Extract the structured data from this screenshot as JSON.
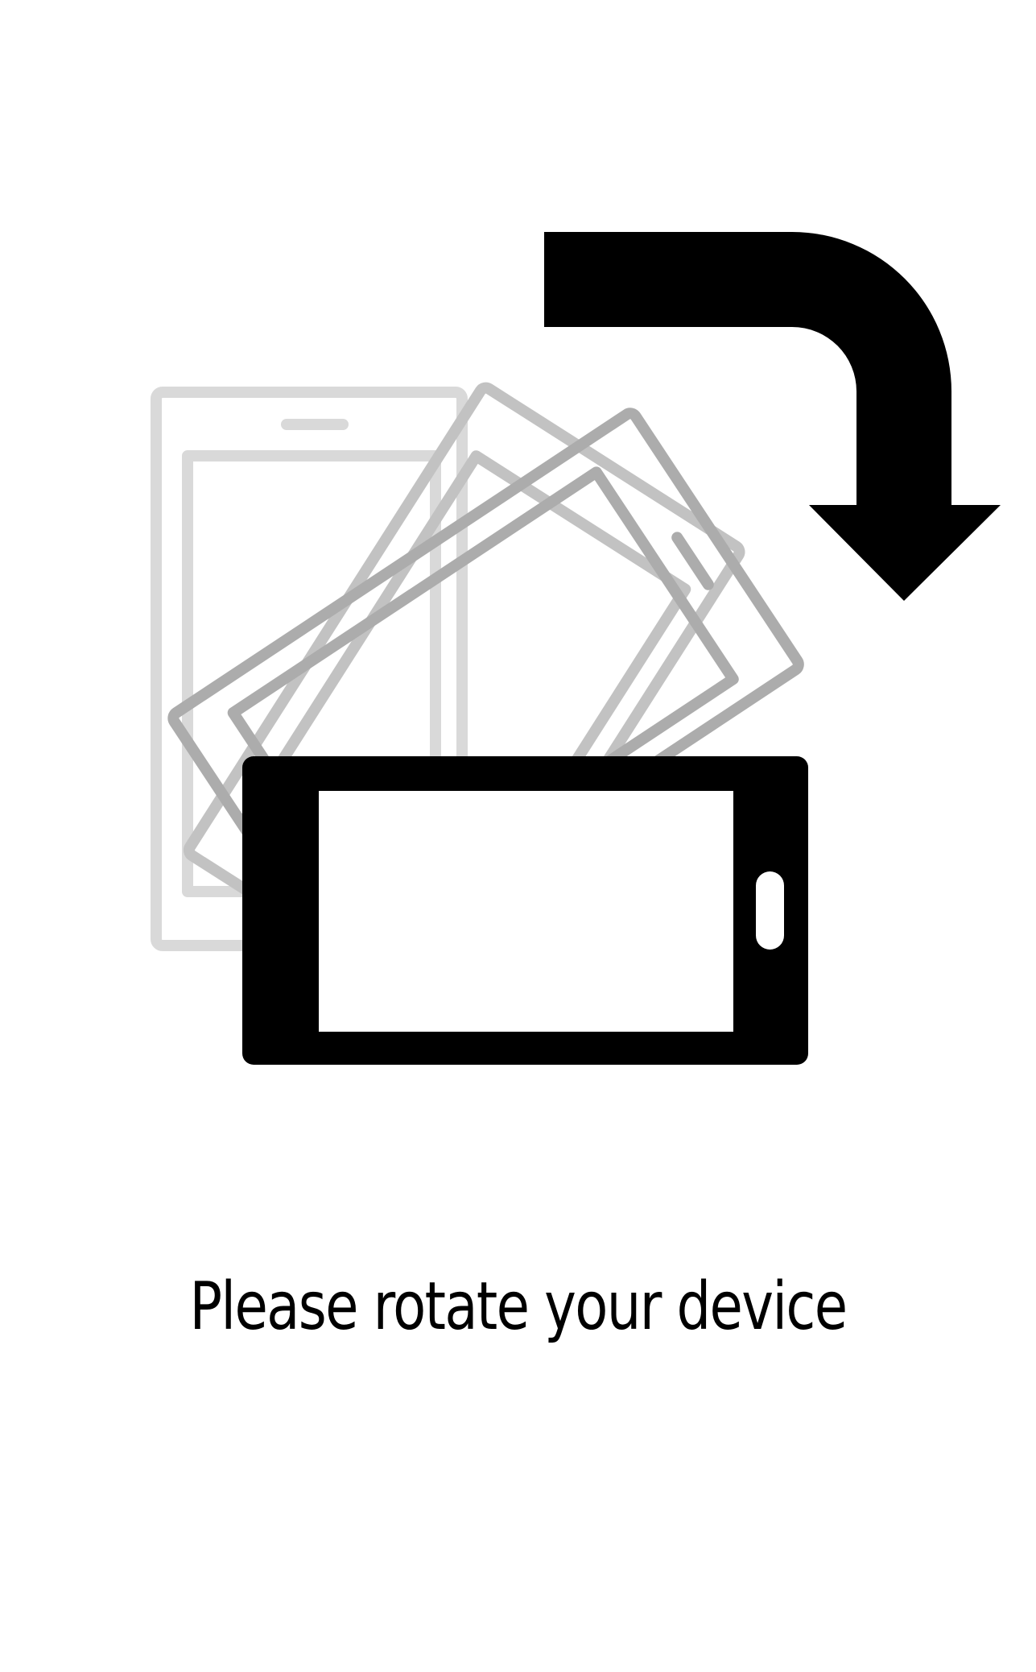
{
  "screen": {
    "message": "Please rotate your device"
  },
  "illustration": {
    "icons": [
      "rotate-arrow-icon",
      "phone-portrait-icon",
      "phone-landscape-icon"
    ],
    "colors": {
      "background": "#ffffff",
      "foreground": "#000000",
      "ghost_light": "#d9d9d9",
      "ghost_mid": "#c2c2c2",
      "ghost_dark": "#acacac"
    }
  }
}
